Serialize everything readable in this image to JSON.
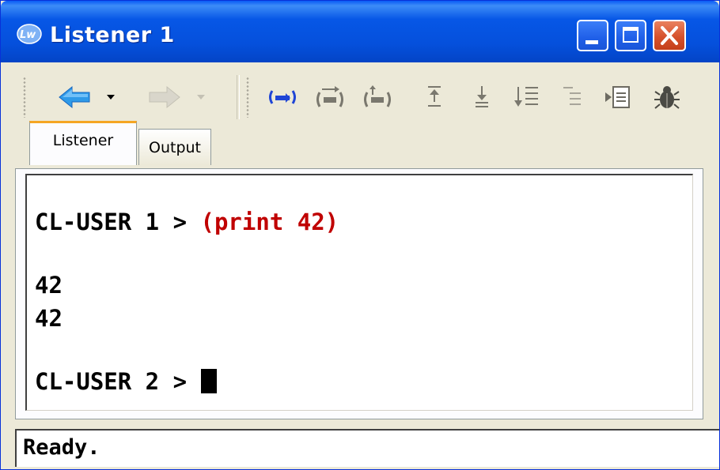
{
  "window": {
    "title": "Listener 1",
    "app_icon": "lispworks-logo-icon"
  },
  "title_buttons": {
    "minimize": "minimize-icon",
    "maximize": "maximize-icon",
    "close": "close-icon"
  },
  "toolbar": {
    "items": [
      {
        "name": "back-arrow-icon",
        "color": "#1e88e5"
      },
      {
        "name": "dropdown-icon"
      },
      {
        "name": "forward-arrow-icon",
        "disabled": true
      },
      {
        "name": "dropdown-icon",
        "disabled": true
      },
      {
        "name": "evaluate-form-icon",
        "color": "#1f45d6"
      },
      {
        "name": "evaluate-next-icon"
      },
      {
        "name": "evaluate-previous-icon"
      },
      {
        "name": "history-first-icon"
      },
      {
        "name": "history-last-icon"
      },
      {
        "name": "history-list-icon"
      },
      {
        "name": "indent-list-icon"
      },
      {
        "name": "inspect-icon"
      },
      {
        "name": "debugger-bug-icon"
      }
    ]
  },
  "tabs": [
    {
      "label": "Listener",
      "active": true
    },
    {
      "label": "Output",
      "active": false
    }
  ],
  "listener": {
    "prompt1": "CL-USER 1 > ",
    "command1": "(print 42)",
    "output1": "42",
    "output2": "42",
    "prompt2": "CL-USER 2 > ",
    "prompt_color": "#000000",
    "command_color": "#c00000"
  },
  "status": {
    "text": "Ready."
  }
}
